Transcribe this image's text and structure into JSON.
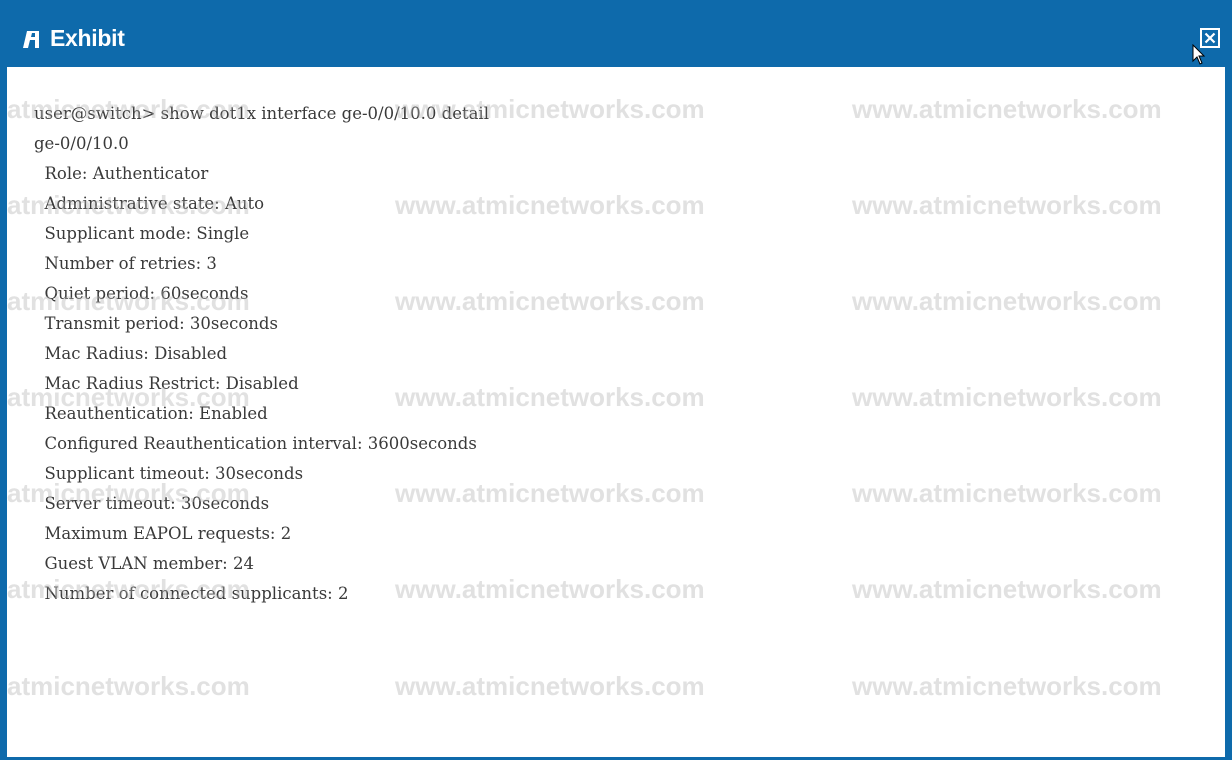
{
  "window": {
    "title": "Exhibit",
    "icon": "exhibit-icon",
    "close_icon": "close-icon",
    "title_bar_color": "#0e6aab"
  },
  "terminal": {
    "command_line": "user@switch> show dot1x interface ge-0/0/10.0 detail",
    "lines": [
      "ge-0/0/10.0",
      "  Role: Authenticator",
      "  Administrative state: Auto",
      "  Supplicant mode: Single",
      "  Number of retries: 3",
      "  Quiet period: 60seconds",
      "  Transmit period: 30seconds",
      "  Mac Radius: Disabled",
      "  Mac Radius Restrict: Disabled",
      "  Reauthentication: Enabled",
      "  Configured Reauthentication interval: 3600seconds",
      "  Supplicant timeout: 30seconds",
      "  Server timeout: 30seconds",
      "  Maximum EAPOL requests: 2",
      "  Guest VLAN member: 24",
      "  Number of connected supplicants: 2"
    ]
  },
  "watermark": {
    "short_text": "atmicnetworks.com",
    "full_text": "www.atmicnetworks.com"
  }
}
